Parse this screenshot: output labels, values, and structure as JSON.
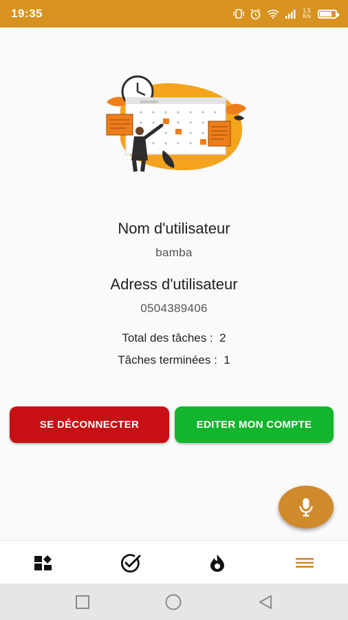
{
  "status_bar": {
    "time": "19:35",
    "icons": [
      "vibrate-icon",
      "alarm-icon",
      "wifi-icon",
      "signal-icon",
      "network-speed-icon",
      "battery-icon"
    ],
    "network_speed": "1.5 K/s"
  },
  "illustration": {
    "name": "calendar-schedule-illustration",
    "calendar_month": "JANUARY"
  },
  "profile": {
    "username_label": "Nom d'utilisateur",
    "username_value": "bamba",
    "address_label": "Adress d'utilisateur",
    "address_value": "0504389406",
    "total_tasks_label": "Total des tâches :",
    "total_tasks_value": "2",
    "done_tasks_label": "Tâches terminées :",
    "done_tasks_value": "1"
  },
  "buttons": {
    "logout_label": "SE DÉCONNECTER",
    "edit_label": "EDITER MON COMPTE"
  },
  "fab": {
    "icon": "microphone-icon"
  },
  "bottom_nav": {
    "items": [
      {
        "icon": "dashboard-icon",
        "active": false
      },
      {
        "icon": "check-circle-icon",
        "active": false
      },
      {
        "icon": "fire-icon",
        "active": false
      },
      {
        "icon": "menu-icon",
        "active": true
      }
    ]
  },
  "colors": {
    "accent": "#d8921f",
    "logout": "#c80f14",
    "edit": "#13b52d",
    "fab": "#cf8a2c"
  }
}
